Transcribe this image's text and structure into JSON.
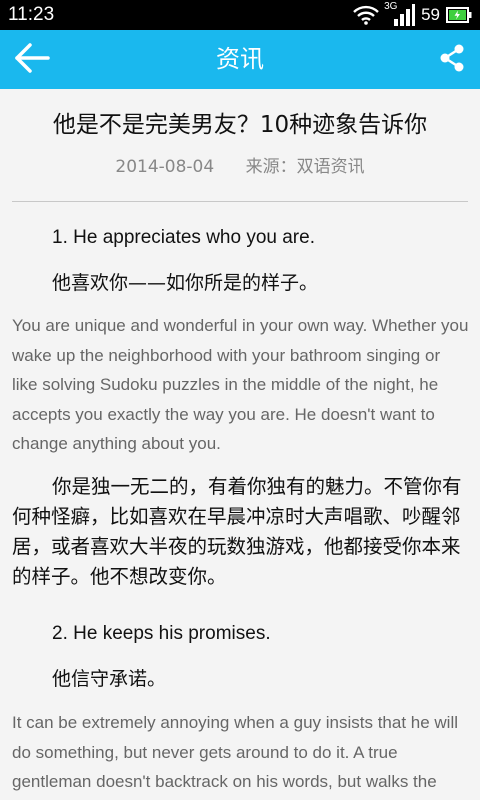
{
  "status_bar": {
    "time": "11:23",
    "battery": "59",
    "network_label": "3G",
    "icons": [
      "wifi-icon",
      "signal-icon",
      "battery-icon"
    ]
  },
  "header": {
    "title": "资讯",
    "back_icon": "arrow-left-icon",
    "share_icon": "share-icon",
    "color": "#1ab8ee"
  },
  "article": {
    "title": "他是不是完美男友？10种迹象告诉你",
    "date": "2014-08-04",
    "source": "来源：双语资讯",
    "sections": [
      {
        "heading_en": "1. He appreciates who you are.",
        "heading_cn": "他喜欢你——如你所是的样子。",
        "para_en": "You are unique and wonderful in your own way. Whether you wake up the neighborhood with your bathroom singing or like solving Sudoku puzzles in the middle of the night, he accepts you exactly the way you are. He doesn't want to change anything about you.",
        "para_cn": "你是独一无二的，有着你独有的魅力。不管你有何种怪癖，比如喜欢在早晨冲凉时大声唱歌、吵醒邻居，或者喜欢大半夜的玩数独游戏，他都接受你本来的样子。他不想改变你。"
      },
      {
        "heading_en": "2. He keeps his promises.",
        "heading_cn": "他信守承诺。",
        "para_en": "It can be extremely annoying when a guy insists that he will do something, but never gets around to do it. A true gentleman doesn't backtrack on his words, but walks the"
      }
    ]
  }
}
